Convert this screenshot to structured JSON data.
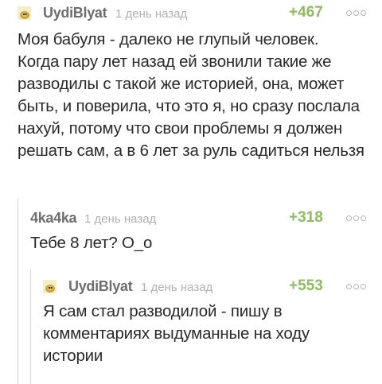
{
  "comments": [
    {
      "author": "UydiBlyat",
      "time": "1 день назад",
      "rating": "+467",
      "text": "Моя бабуля - далеко не глупый человек. Когда пару лет назад ей звонили такие же разводилы с такой же историей, она, может быть, и поверила, что это я, но сразу послала нахуй, потому что свои проблемы я должен решать сам, а в 6 лет за руль садиться нельзя",
      "avatar": "avatar-icon"
    },
    {
      "author": "4ka4ka",
      "time": "1 день назад",
      "rating": "+318",
      "text": "Тебе 8 лет? O_o"
    },
    {
      "author": "UydiBlyat",
      "time": "1 день назад",
      "rating": "+553",
      "text": "Я сам стал разводилой - пишу в комментариях выдуманные на ходу истории",
      "avatar": "avatar-icon"
    }
  ],
  "colors": {
    "rating": "#8bbf5c",
    "author": "#6e6e6e",
    "time": "#b0b0b0",
    "thread_line": "#d5d5d5"
  },
  "icons": {
    "more": "more-options-icon"
  }
}
